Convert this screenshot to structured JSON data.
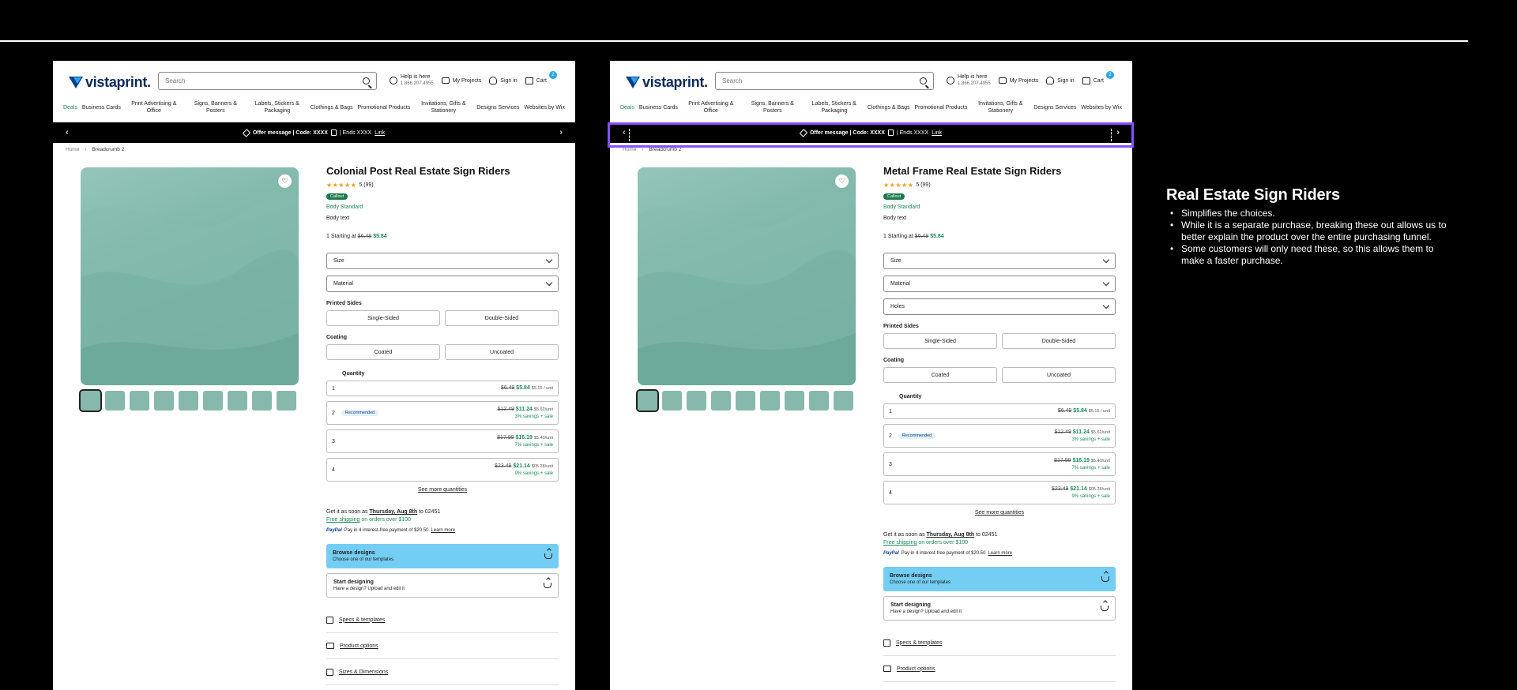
{
  "header": {
    "logo_text": "vistaprint.",
    "search_placeholder": "Search",
    "help_title": "Help is here",
    "help_phone": "1.866.207.4955",
    "my_projects": "My Projects",
    "sign_in": "Sign in",
    "cart": "Cart",
    "cart_count": "2"
  },
  "nav": [
    {
      "label": "Deals",
      "active": true
    },
    {
      "label": "Business Cards"
    },
    {
      "label": "Print Advertising & Office"
    },
    {
      "label": "Signs, Banners & Posters"
    },
    {
      "label": "Labels, Stickers & Packaging"
    },
    {
      "label": "Clothings & Bags"
    },
    {
      "label": "Promotional Products"
    },
    {
      "label": "Invitations, Gifts & Stationery"
    },
    {
      "label": "Designs Services"
    },
    {
      "label": "Websites by Wix"
    }
  ],
  "promo": {
    "message": "Offer message | Code: XXXX",
    "ends": "| Ends XXXX",
    "link": "Link"
  },
  "breadcrumb": {
    "home": "Home",
    "current": "Breadcrumb 2"
  },
  "pages": [
    {
      "title": "Colonial Post Real Estate Sign Riders",
      "selects": [
        "Size",
        "Material"
      ]
    },
    {
      "title": "Metal Frame Real Estate Sign Riders",
      "selects": [
        "Size",
        "Material",
        "Holes"
      ]
    }
  ],
  "product": {
    "stars": "★★★★★",
    "rating_count": "5 (99)",
    "callout": "Callout",
    "body_standard": "Body Standard",
    "body_text": "Body text",
    "price_prefix": "1 Starting at",
    "price_original": "$6.49",
    "price_sale": "$5.84",
    "printed_sides_label": "Printed Sides",
    "printed_sides": [
      "Single-Sided",
      "Double-Sided"
    ],
    "coating_label": "Coating",
    "coating": [
      "Coated",
      "Uncoated"
    ],
    "quantity_label": "Quantity",
    "quantities": [
      {
        "qty": "1",
        "original": "$6.49",
        "sale": "$5.84",
        "unit": "$5.15 / unit",
        "savings": ""
      },
      {
        "qty": "2",
        "badge": "Recommended",
        "original": "$12.49",
        "sale": "$11.24",
        "unit": "$5.62/unit",
        "savings": "3% savings + sale"
      },
      {
        "qty": "3",
        "original": "$17.99",
        "sale": "$16.19",
        "unit": "$5.40/unit",
        "savings": "7% savings + sale"
      },
      {
        "qty": "4",
        "original": "$23.49",
        "sale": "$21.14",
        "unit": "$05.28/unit",
        "savings": "9% savings + sale"
      }
    ],
    "see_more": "See more quantities",
    "delivery_prefix": "Get it as soon as",
    "delivery_date": "Thursday, Aug 8th",
    "delivery_suffix": "to 02451",
    "free_shipping": "Free shipping",
    "free_shipping_suffix": "on orders over $100",
    "paypal_logo": "PayPal",
    "paypal_text": "Pay in 4 interest-free payment of $20.50",
    "learn_more": "Learn more",
    "browse_title": "Browse designs",
    "browse_sub": "Choose one of our templates",
    "start_title": "Start designing",
    "start_sub": "Have a design? Upload and edit it",
    "specs": "Specs & templates",
    "product_options": "Product options",
    "sizes_dims": "Sizes & Dimensions"
  },
  "notes": {
    "title": "Real Estate Sign Riders",
    "bullets": [
      "Simplifies the choices.",
      "While it is a separate purchase, breaking these out allows us to better explain the product over the entire purchasing funnel.",
      "Some customers will only need these, so this allows them to make a faster purchase."
    ]
  },
  "colors": {
    "accent_green": "#1a8a57",
    "cta_blue": "#74cdf2",
    "selection_purple": "#8a4fff",
    "star_orange": "#f29b1d"
  }
}
